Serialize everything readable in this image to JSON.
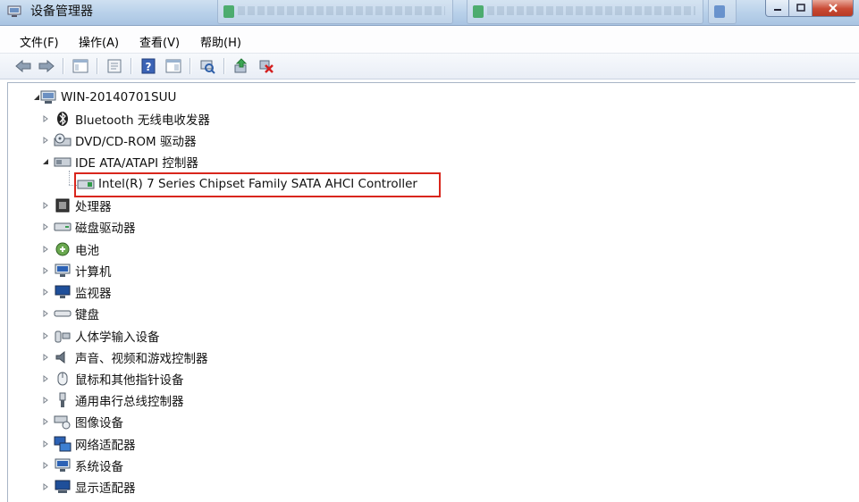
{
  "window": {
    "title": "设备管理器"
  },
  "menu": [
    "文件(F)",
    "操作(A)",
    "查看(V)",
    "帮助(H)"
  ],
  "toolbar_icons": [
    "back-arrow-icon",
    "forward-arrow-icon",
    "show-hide-tree-icon",
    "properties-icon",
    "help-icon",
    "view-icon",
    "scan-hardware-icon",
    "update-driver-icon",
    "uninstall-icon"
  ],
  "tree": {
    "root": "WIN-20140701SUU",
    "categories": [
      {
        "label": "Bluetooth 无线电收发器",
        "icon": "bluetooth-icon",
        "expanded": false
      },
      {
        "label": "DVD/CD-ROM 驱动器",
        "icon": "dvd-drive-icon",
        "expanded": false
      },
      {
        "label": "IDE ATA/ATAPI 控制器",
        "icon": "ide-controller-icon",
        "expanded": true,
        "children": [
          {
            "label": "Intel(R) 7 Series Chipset Family SATA AHCI Controller",
            "icon": "controller-device-icon",
            "highlighted": true
          }
        ]
      },
      {
        "label": "处理器",
        "icon": "processor-icon",
        "expanded": false
      },
      {
        "label": "磁盘驱动器",
        "icon": "disk-drive-icon",
        "expanded": false
      },
      {
        "label": "电池",
        "icon": "battery-icon",
        "expanded": false
      },
      {
        "label": "计算机",
        "icon": "computer-icon",
        "expanded": false
      },
      {
        "label": "监视器",
        "icon": "monitor-icon",
        "expanded": false
      },
      {
        "label": "键盘",
        "icon": "keyboard-icon",
        "expanded": false
      },
      {
        "label": "人体学输入设备",
        "icon": "hid-icon",
        "expanded": false
      },
      {
        "label": "声音、视频和游戏控制器",
        "icon": "speaker-icon",
        "expanded": false
      },
      {
        "label": "鼠标和其他指针设备",
        "icon": "mouse-icon",
        "expanded": false
      },
      {
        "label": "通用串行总线控制器",
        "icon": "usb-icon",
        "expanded": false
      },
      {
        "label": "图像设备",
        "icon": "camera-icon",
        "expanded": false
      },
      {
        "label": "网络适配器",
        "icon": "network-icon",
        "expanded": false
      },
      {
        "label": "系统设备",
        "icon": "system-device-icon",
        "expanded": false
      },
      {
        "label": "显示适配器",
        "icon": "display-adapter-icon",
        "expanded": false
      }
    ]
  },
  "colors": {
    "highlight_border": "#d9261c",
    "titlebar": "#b9d1ea"
  }
}
